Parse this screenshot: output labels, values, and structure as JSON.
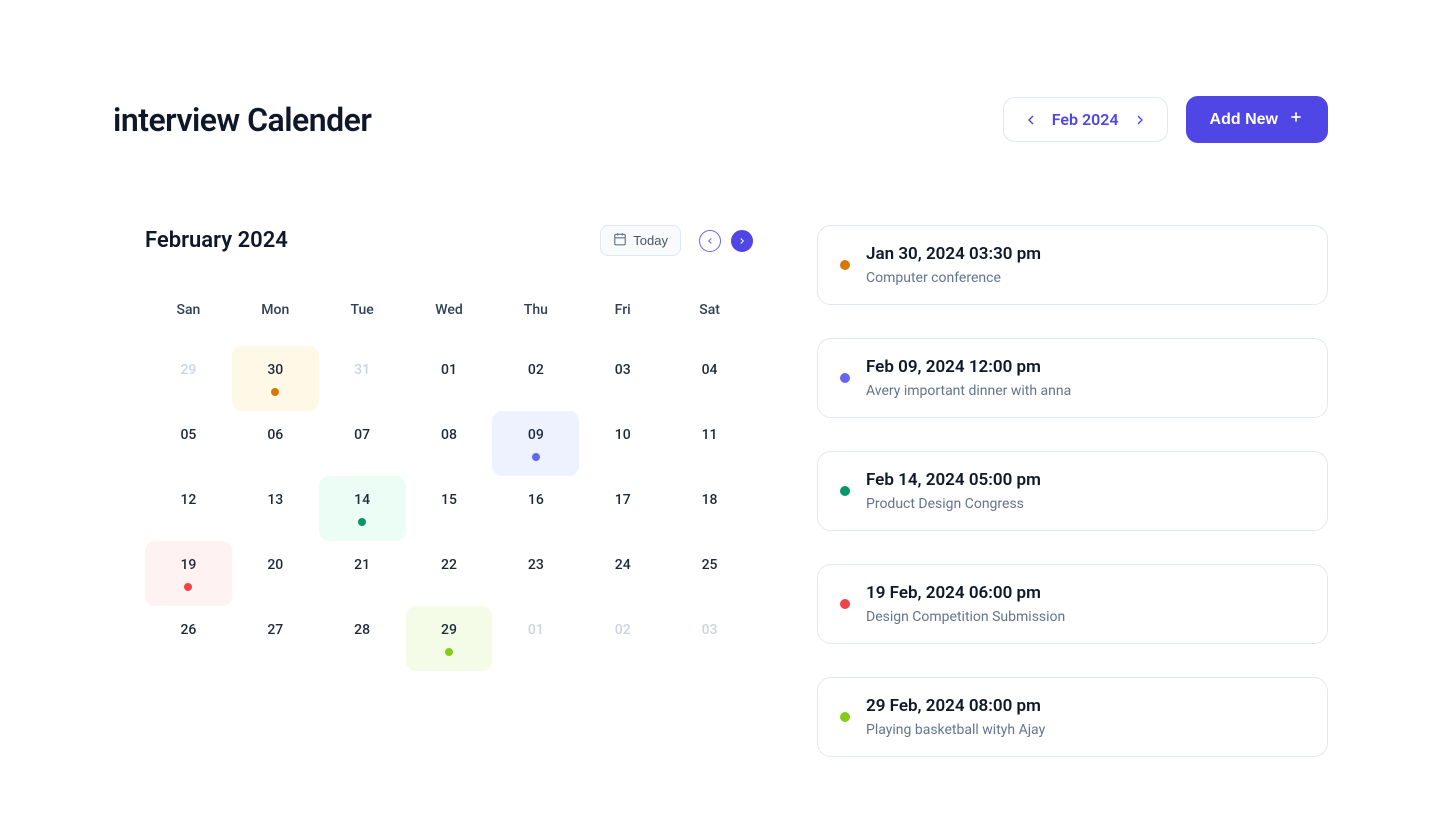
{
  "header": {
    "title": "interview Calender",
    "month_selector_label": "Feb 2024",
    "add_new_label": "Add New"
  },
  "calendar": {
    "title": "February 2024",
    "today_label": "Today",
    "weekdays": [
      "San",
      "Mon",
      "Tue",
      "Wed",
      "Thu",
      "Fri",
      "Sat"
    ],
    "days": [
      {
        "num": "29",
        "other": true
      },
      {
        "num": "30",
        "bg": "bg-amber",
        "dot": "dot-amber"
      },
      {
        "num": "31",
        "other": true
      },
      {
        "num": "01"
      },
      {
        "num": "02"
      },
      {
        "num": "03"
      },
      {
        "num": "04"
      },
      {
        "num": "05"
      },
      {
        "num": "06"
      },
      {
        "num": "07"
      },
      {
        "num": "08"
      },
      {
        "num": "09",
        "bg": "bg-indigo",
        "dot": "dot-indigo"
      },
      {
        "num": "10"
      },
      {
        "num": "11"
      },
      {
        "num": "12"
      },
      {
        "num": "13"
      },
      {
        "num": "14",
        "bg": "bg-green",
        "dot": "dot-green"
      },
      {
        "num": "15"
      },
      {
        "num": "16"
      },
      {
        "num": "17"
      },
      {
        "num": "18"
      },
      {
        "num": "19",
        "bg": "bg-red",
        "dot": "dot-red"
      },
      {
        "num": "20"
      },
      {
        "num": "21"
      },
      {
        "num": "22"
      },
      {
        "num": "23"
      },
      {
        "num": "24"
      },
      {
        "num": "25"
      },
      {
        "num": "26"
      },
      {
        "num": "27"
      },
      {
        "num": "28"
      },
      {
        "num": "29",
        "bg": "bg-lime",
        "dot": "dot-lime"
      },
      {
        "num": "01",
        "other": true
      },
      {
        "num": "02",
        "other": true
      },
      {
        "num": "03",
        "other": true
      }
    ]
  },
  "events": [
    {
      "dot": "dot-amber",
      "time": "Jan 30, 2024 03:30 pm",
      "desc": "Computer conference"
    },
    {
      "dot": "dot-indigo",
      "time": "Feb 09, 2024 12:00 pm",
      "desc": "Avery important dinner with anna"
    },
    {
      "dot": "dot-green",
      "time": "Feb 14, 2024 05:00 pm",
      "desc": "Product Design Congress"
    },
    {
      "dot": "dot-red",
      "time": "19 Feb, 2024 06:00 pm",
      "desc": "Design Competition Submission"
    },
    {
      "dot": "dot-lime",
      "time": "29 Feb, 2024 08:00 pm",
      "desc": "Playing basketball wityh Ajay"
    }
  ]
}
